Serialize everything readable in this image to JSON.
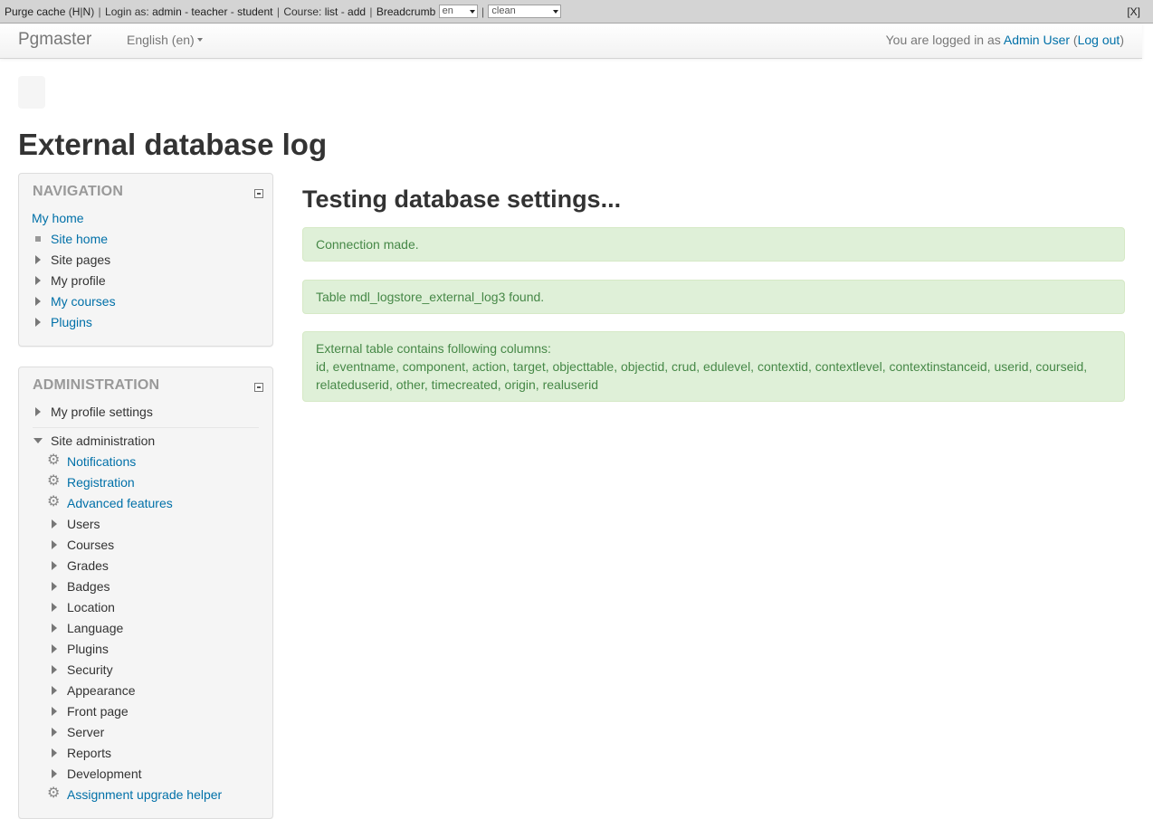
{
  "devbar": {
    "purge_cache": "Purge cache",
    "purge_h": "H",
    "purge_n": "N",
    "login_as_label": "Login as:",
    "login_admin": "admin",
    "login_teacher": "teacher",
    "login_student": "student",
    "course_label": "Course:",
    "course_list": "list",
    "course_add": "add",
    "breadcrumb": "Breadcrumb",
    "lang_value": "en",
    "theme_value": "clean",
    "close": "[X]"
  },
  "navbar": {
    "brand": "Pgmaster",
    "language": "English (en)",
    "logged_in_prefix": "You are logged in as",
    "user_name": "Admin User",
    "logout": "Log out"
  },
  "page": {
    "title": "External database log"
  },
  "navigation": {
    "title": "NAVIGATION",
    "items": [
      {
        "label": "My home"
      },
      {
        "label": "Site home"
      },
      {
        "label": "Site pages"
      },
      {
        "label": "My profile"
      },
      {
        "label": "My courses"
      },
      {
        "label": "Plugins"
      }
    ]
  },
  "administration": {
    "title": "ADMINISTRATION",
    "items": [
      {
        "label": "My profile settings"
      },
      {
        "label": "Site administration"
      },
      {
        "label": "Notifications"
      },
      {
        "label": "Registration"
      },
      {
        "label": "Advanced features"
      },
      {
        "label": "Users"
      },
      {
        "label": "Courses"
      },
      {
        "label": "Grades"
      },
      {
        "label": "Badges"
      },
      {
        "label": "Location"
      },
      {
        "label": "Language"
      },
      {
        "label": "Plugins"
      },
      {
        "label": "Security"
      },
      {
        "label": "Appearance"
      },
      {
        "label": "Front page"
      },
      {
        "label": "Server"
      },
      {
        "label": "Reports"
      },
      {
        "label": "Development"
      },
      {
        "label": "Assignment upgrade helper"
      }
    ]
  },
  "main": {
    "heading": "Testing database settings...",
    "alerts": [
      {
        "text": "Connection made."
      },
      {
        "text": "Table mdl_logstore_external_log3 found."
      },
      {
        "line1": "External table contains following columns:",
        "line2": "id, eventname, component, action, target, objecttable, objectid, crud, edulevel, contextid, contextlevel, contextinstanceid, userid, courseid,",
        "line3": "relateduserid, other, timecreated, origin, realuserid"
      }
    ]
  },
  "colors": {
    "link": "#0070a8",
    "alert_bg": "#dff0d8",
    "alert_text": "#468847",
    "block_bg": "#f5f5f5"
  }
}
